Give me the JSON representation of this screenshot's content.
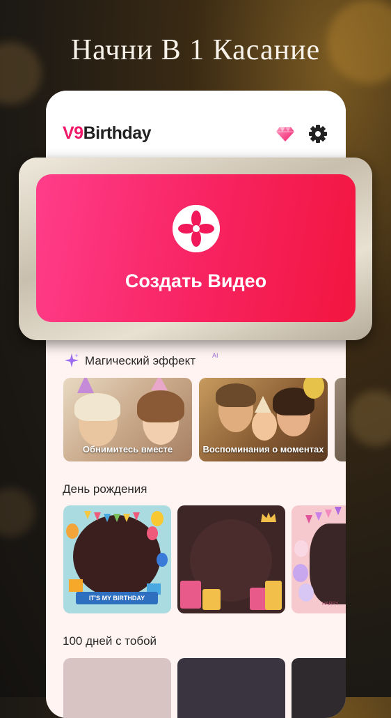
{
  "headline": "Начни В 1 Касание",
  "app": {
    "logo_prefix": "V9",
    "logo_rest": "Birthday",
    "premium_icon": "diamond-icon",
    "settings_icon": "gear-icon"
  },
  "create": {
    "label": "Создать Видео",
    "icon": "create-video-icon"
  },
  "magic": {
    "title": "Магический эффект",
    "badge": "AI",
    "cards": [
      {
        "label": "Обнимитесь вместе"
      },
      {
        "label": "Воспоминания о моментах"
      }
    ]
  },
  "birthday": {
    "title": "День рождения",
    "frame_text": "IT'S MY BIRTHDAY",
    "frame_text_2": "HAPPY"
  },
  "hundred_days": {
    "title": "100 дней с тобой"
  },
  "colors": {
    "accent": "#f0196a",
    "create_gradient_start": "#ff3d8a",
    "create_gradient_end": "#f2163f"
  }
}
